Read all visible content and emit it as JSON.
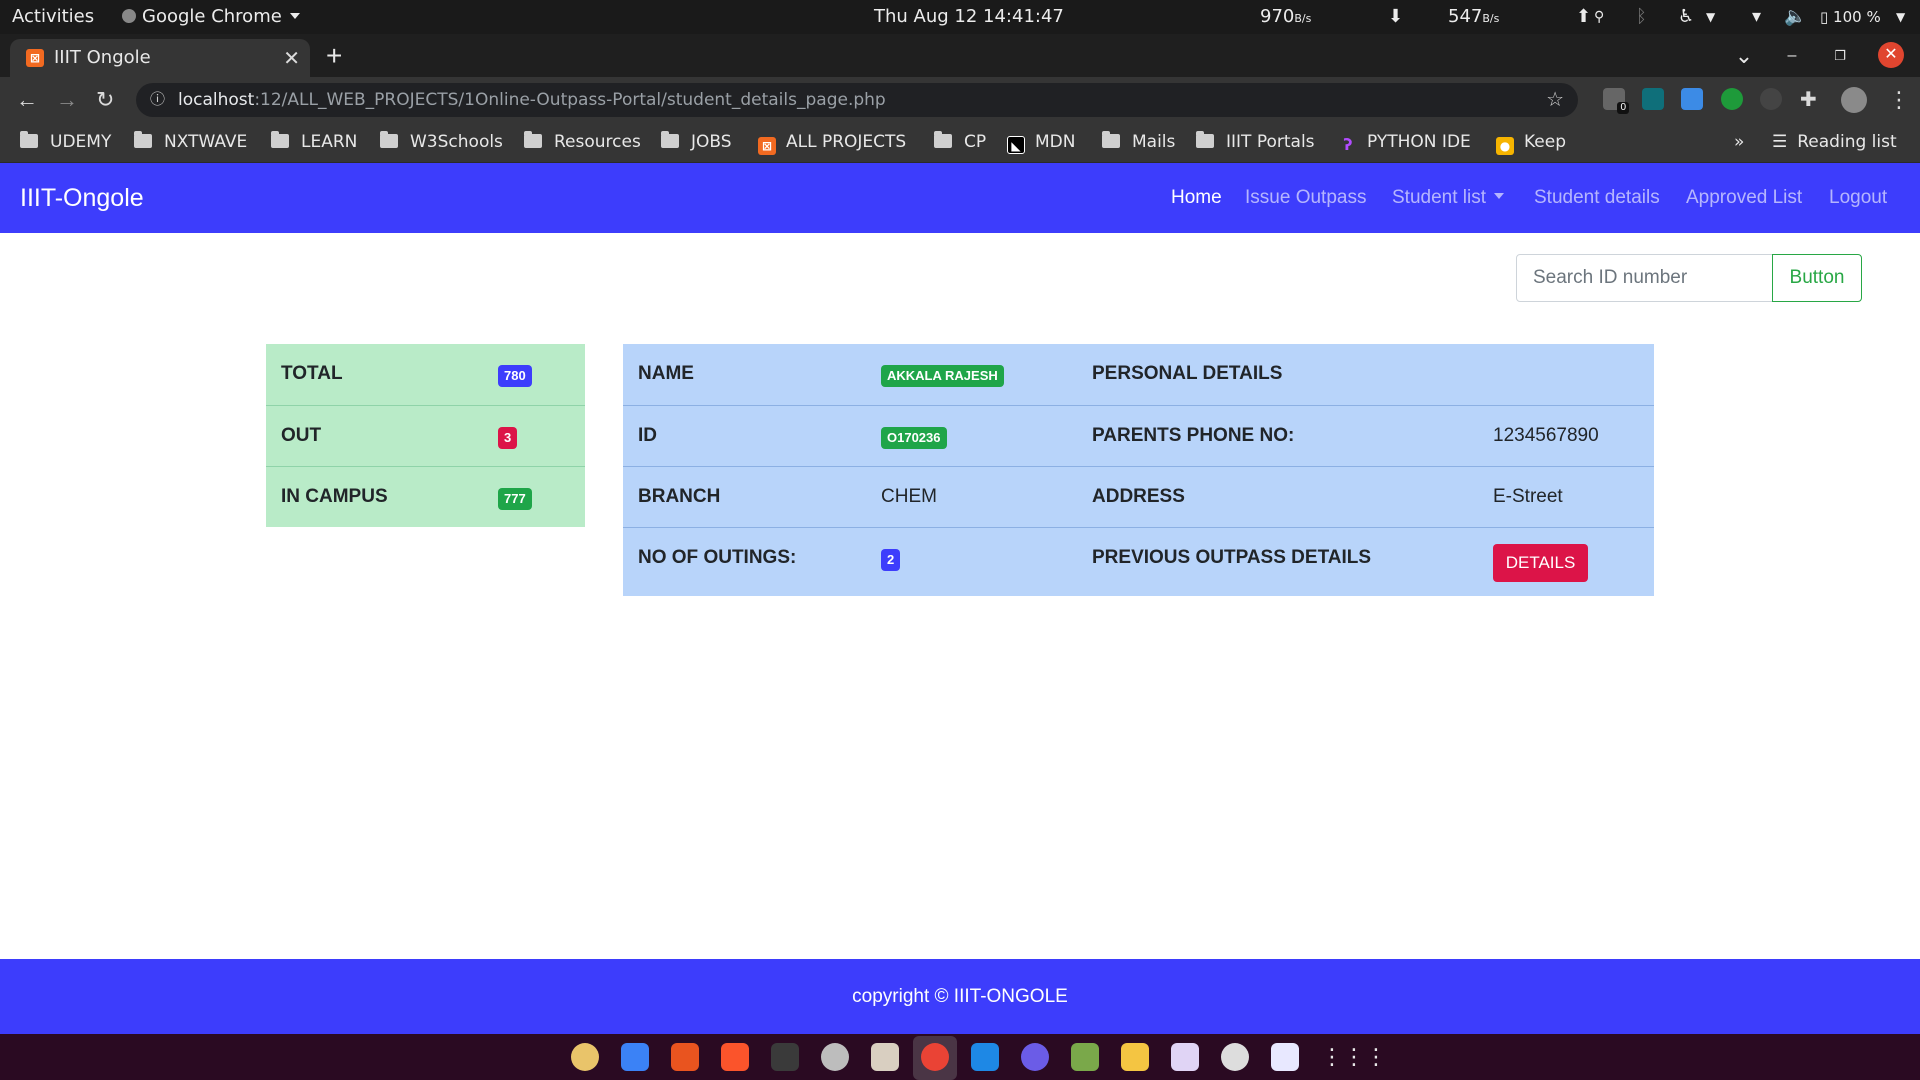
{
  "os_bar": {
    "activities": "Activities",
    "app_menu": "Google Chrome",
    "datetime": "Thu Aug 12  14:41:47",
    "download_speed": "970",
    "download_unit": "B/s",
    "upload_speed": "547",
    "upload_unit": "B/s",
    "battery": "100 %"
  },
  "browser": {
    "tab_title": "IIIT Ongole",
    "url_host": "localhost",
    "url_path": ":12/ALL_WEB_PROJECTS/1Online-Outpass-Portal/student_details_page.php",
    "extension_badge": "0",
    "bookmarks": [
      {
        "label": "UDEMY",
        "icon": "folder-icon"
      },
      {
        "label": "NXTWAVE",
        "icon": "folder-icon"
      },
      {
        "label": "LEARN",
        "icon": "folder-icon"
      },
      {
        "label": "W3Schools",
        "icon": "folder-icon"
      },
      {
        "label": "Resources",
        "icon": "folder-icon"
      },
      {
        "label": "JOBS",
        "icon": "folder-icon"
      },
      {
        "label": "ALL PROJECTS",
        "icon": "xampp-icon"
      },
      {
        "label": "CP",
        "icon": "folder-icon"
      },
      {
        "label": "MDN",
        "icon": "mdn-icon"
      },
      {
        "label": "Mails",
        "icon": "folder-icon"
      },
      {
        "label": "IIIT Portals",
        "icon": "folder-icon"
      },
      {
        "label": "PYTHON IDE",
        "icon": "python-icon"
      },
      {
        "label": "Keep",
        "icon": "keep-icon"
      }
    ],
    "overflow": "»",
    "reading_list": "Reading list"
  },
  "navbar": {
    "brand": "IIIT-Ongole",
    "links": [
      "Home",
      "Issue Outpass",
      "Student list",
      "Student details",
      "Approved List",
      "Logout"
    ]
  },
  "search": {
    "placeholder": "Search ID number",
    "button": "Button"
  },
  "stats": [
    {
      "label": "TOTAL",
      "value": "780",
      "color": "#3d3dfc"
    },
    {
      "label": "OUT",
      "value": "3",
      "color": "#dc1448"
    },
    {
      "label": "IN CAMPUS",
      "value": "777",
      "color": "#1fa549"
    }
  ],
  "student": {
    "name_label": "NAME",
    "name": "AKKALA RAJESH",
    "personal_details": "PERSONAL DETAILS",
    "id_label": "ID",
    "id": "O170236",
    "parents_phone_label": "PARENTS PHONE NO:",
    "parents_phone": "1234567890",
    "branch_label": "BRANCH",
    "branch": "CHEM",
    "address_label": "ADDRESS",
    "address": "E-Street",
    "outings_label": "NO OF OUTINGS:",
    "outings": "2",
    "previous_label": "PREVIOUS OUTPASS DETAILS",
    "details_button": "DETAILS"
  },
  "footer": {
    "copyright": "copyright © IIIT-ONGOLE"
  },
  "colors": {
    "primary": "#3d3dfc",
    "success": "#1fa549",
    "danger": "#dc1448",
    "stats_bg": "#b9ebc8",
    "details_bg": "#b8d4fa"
  }
}
